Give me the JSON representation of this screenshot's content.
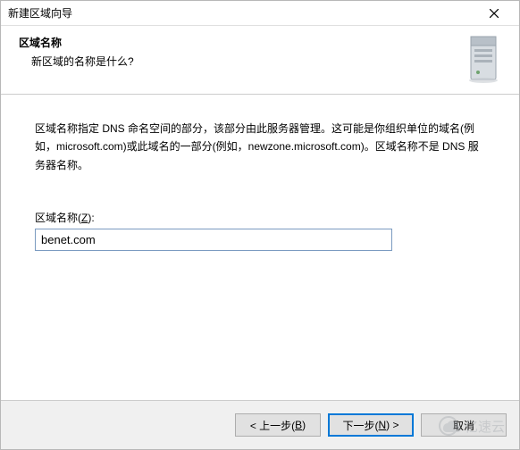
{
  "titlebar": {
    "title": "新建区域向导"
  },
  "header": {
    "title": "区域名称",
    "subtitle": "新区域的名称是什么?"
  },
  "content": {
    "description": "区域名称指定 DNS 命名空间的部分，该部分由此服务器管理。这可能是你组织单位的域名(例如，microsoft.com)或此域名的一部分(例如，newzone.microsoft.com)。区域名称不是 DNS 服务器名称。",
    "field_label_prefix": "区域名称(",
    "field_label_key": "Z",
    "field_label_suffix": "):",
    "field_value": "benet.com"
  },
  "footer": {
    "back_prefix": "< 上一步(",
    "back_key": "B",
    "back_suffix": ")",
    "next_prefix": "下一步(",
    "next_key": "N",
    "next_suffix": ") >",
    "cancel": "取消"
  },
  "watermark": "亿速云"
}
